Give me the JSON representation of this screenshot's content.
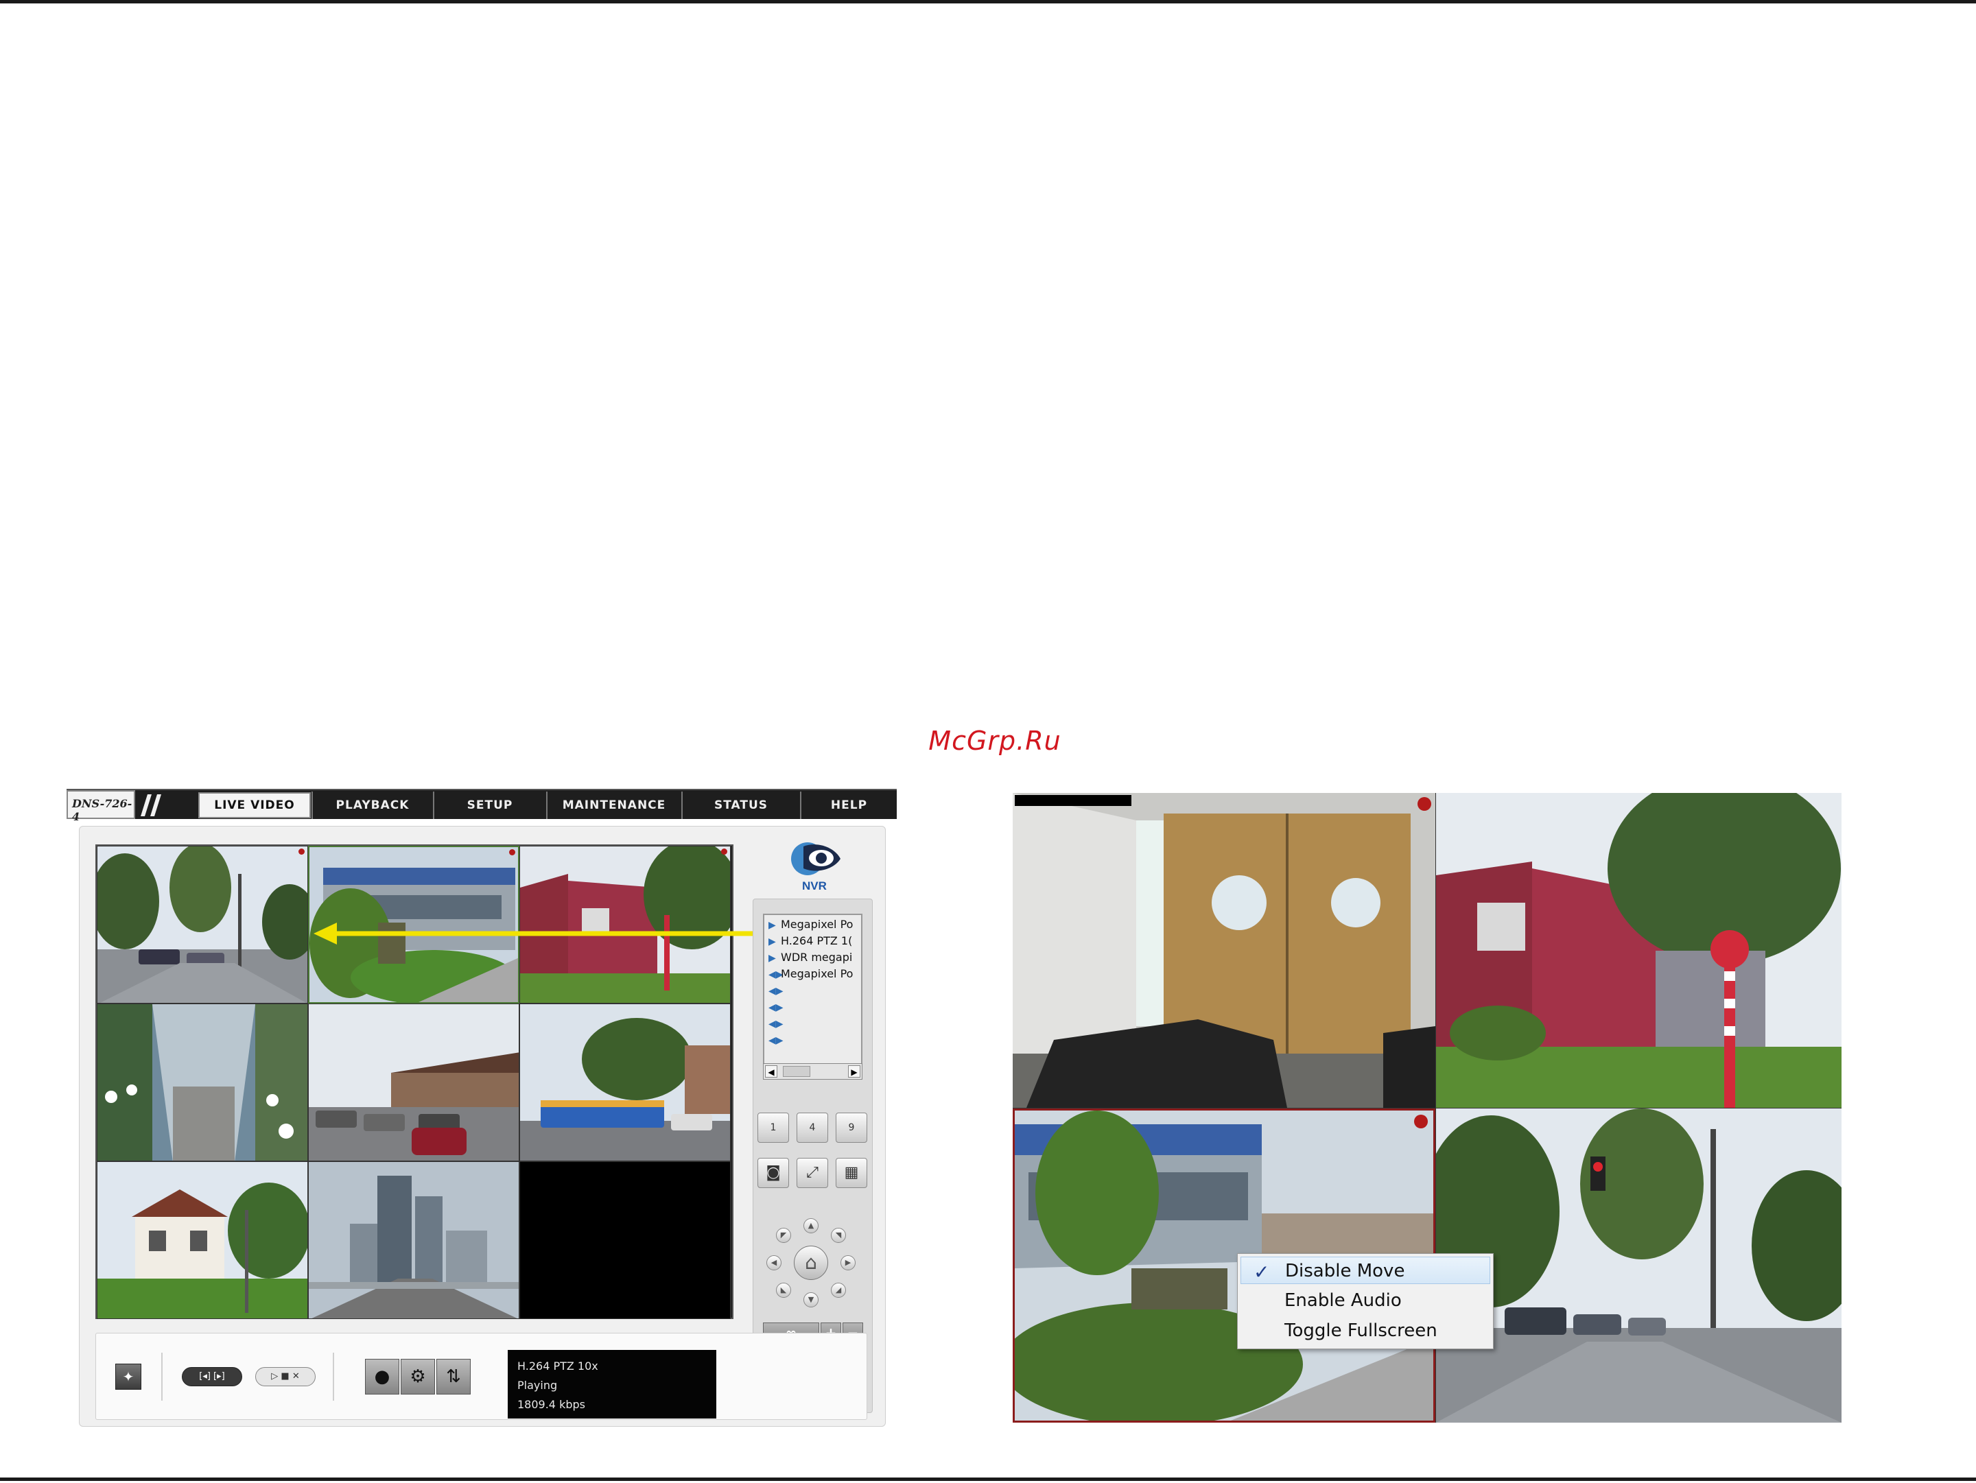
{
  "watermark": "McGrp.Ru",
  "app": {
    "brand": "DNS-726-4",
    "tabs": [
      {
        "label": "LIVE VIDEO",
        "active": true
      },
      {
        "label": "PLAYBACK",
        "active": false
      },
      {
        "label": "SETUP",
        "active": false
      },
      {
        "label": "MAINTENANCE",
        "active": false
      },
      {
        "label": "STATUS",
        "active": false
      },
      {
        "label": "HELP",
        "active": false
      }
    ],
    "logo_text": "NVR",
    "camera_list": [
      {
        "icon": "play-icon",
        "label": "Megapixel Po"
      },
      {
        "icon": "play-icon",
        "label": "H.264 PTZ 1("
      },
      {
        "icon": "play-icon",
        "label": "WDR megapi"
      },
      {
        "icon": "audio-icon",
        "label": "Megapixel Po"
      },
      {
        "icon": "audio-icon",
        "label": ""
      },
      {
        "icon": "audio-icon",
        "label": ""
      },
      {
        "icon": "audio-icon",
        "label": ""
      },
      {
        "icon": "audio-icon",
        "label": ""
      }
    ],
    "layout_buttons": [
      "1",
      "4",
      "9"
    ],
    "status": {
      "camera": "H.264 PTZ 10x",
      "state": "Playing",
      "bitrate": "1809.4 kbps"
    },
    "accent_color": "#f2e300"
  },
  "context_menu": {
    "items": [
      {
        "label": "Disable Move",
        "checked": true
      },
      {
        "label": "Enable Audio",
        "checked": false
      },
      {
        "label": "Toggle Fullscreen",
        "checked": false
      }
    ]
  }
}
